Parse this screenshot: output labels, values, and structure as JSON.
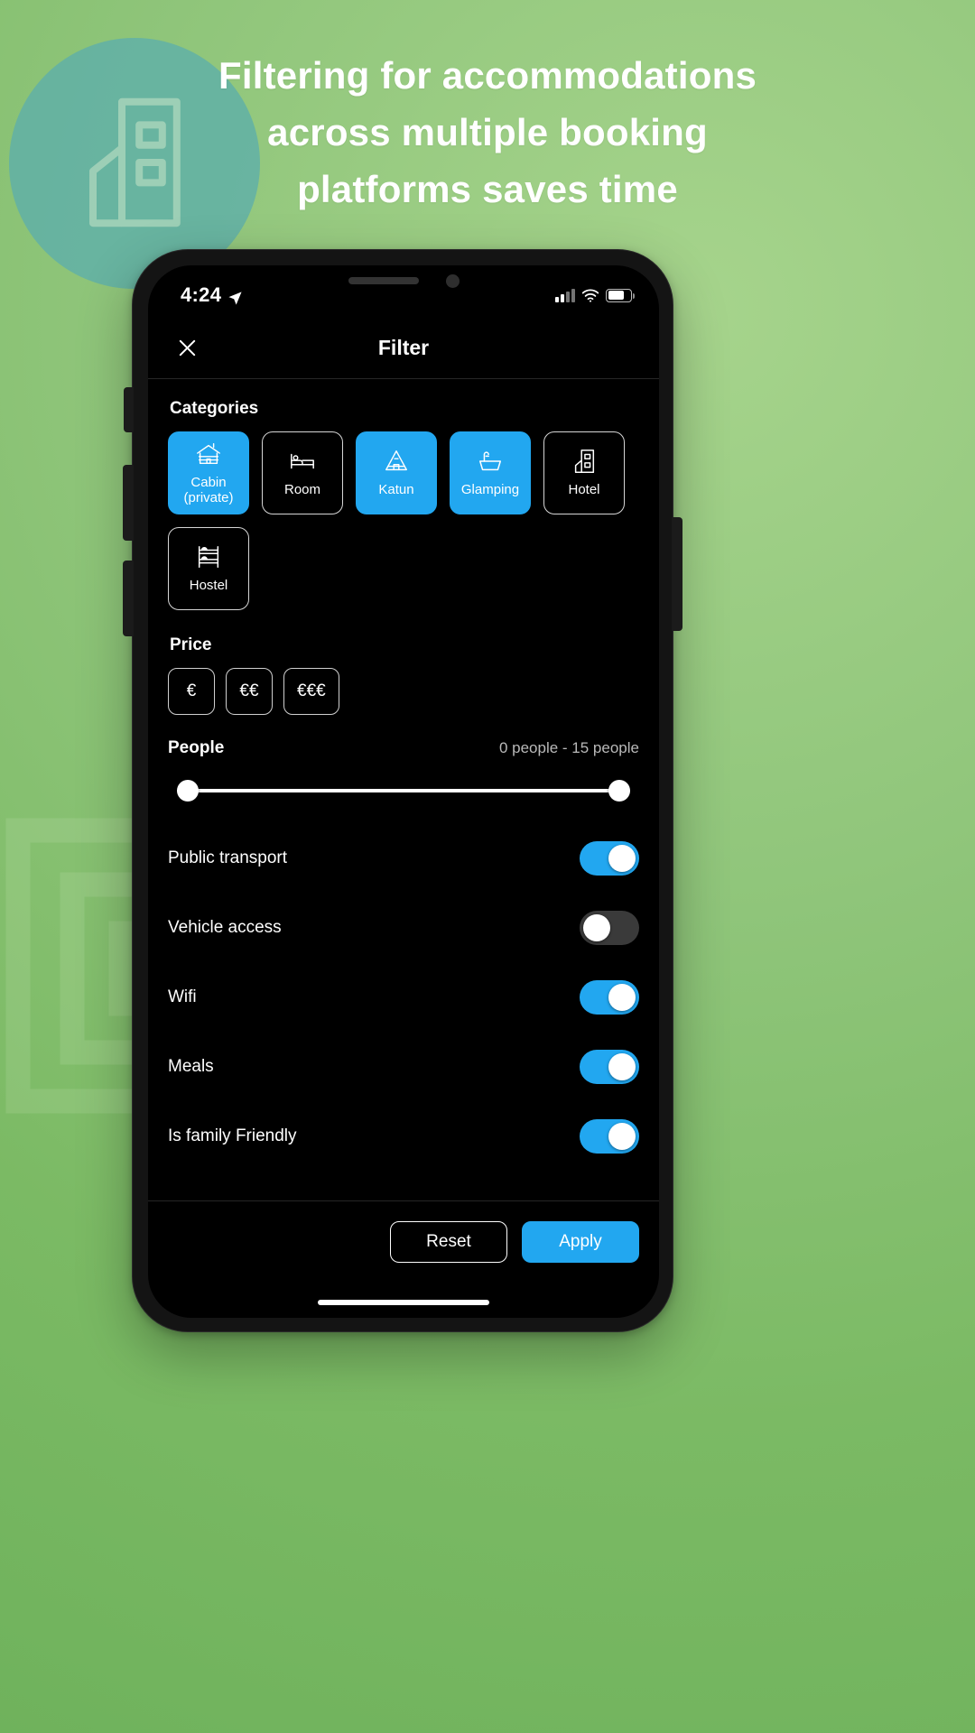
{
  "promo": {
    "headline_lines": [
      "Filtering for accommodations",
      "across multiple booking",
      "platforms saves time"
    ],
    "background_color": "#7cb96a",
    "accent_color": "#22a7f0"
  },
  "status_bar": {
    "time": "4:24",
    "location_icon": "location-arrow-icon",
    "signal_icon": "cellular-signal-icon",
    "wifi_icon": "wifi-icon",
    "battery_icon": "battery-icon"
  },
  "header": {
    "close_icon": "close-icon",
    "title": "Filter"
  },
  "categories": {
    "label": "Categories",
    "items": [
      {
        "label": "Cabin\n(private)",
        "line1": "Cabin",
        "line2": "(private)",
        "icon": "cabin-icon",
        "selected": true
      },
      {
        "label": "Room",
        "line1": "Room",
        "line2": "",
        "icon": "bed-icon",
        "selected": false
      },
      {
        "label": "Katun",
        "line1": "Katun",
        "line2": "",
        "icon": "a-frame-hut-icon",
        "selected": true
      },
      {
        "label": "Glamping",
        "line1": "Glamping",
        "line2": "",
        "icon": "bathtub-icon",
        "selected": true
      },
      {
        "label": "Hotel",
        "line1": "Hotel",
        "line2": "",
        "icon": "hotel-building-icon",
        "selected": false
      },
      {
        "label": "Hostel",
        "line1": "Hostel",
        "line2": "",
        "icon": "bunk-bed-icon",
        "selected": false
      }
    ]
  },
  "price": {
    "label": "Price",
    "options": [
      {
        "label": "€",
        "selected": false
      },
      {
        "label": "€€",
        "selected": false
      },
      {
        "label": "€€€",
        "selected": false
      }
    ]
  },
  "people": {
    "label": "People",
    "range_text": "0 people - 15 people",
    "min": 0,
    "max": 15
  },
  "toggles": [
    {
      "label": "Public transport",
      "on": true
    },
    {
      "label": "Vehicle access",
      "on": false
    },
    {
      "label": "Wifi",
      "on": true
    },
    {
      "label": "Meals",
      "on": true
    },
    {
      "label": "Is family Friendly",
      "on": true
    }
  ],
  "footer": {
    "reset_label": "Reset",
    "apply_label": "Apply"
  }
}
